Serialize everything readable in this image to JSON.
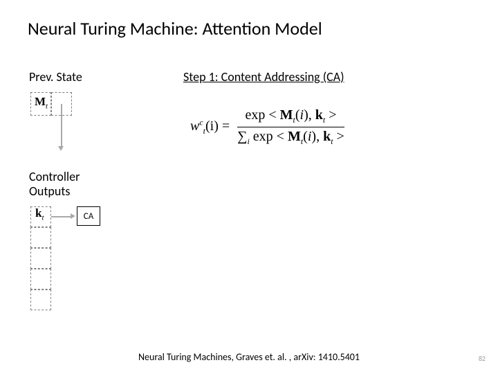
{
  "title": "Neural Turing Machine: Attention Model",
  "prev_state_label": "Prev. State",
  "controller_label_line1": "Controller",
  "controller_label_line2": "Outputs",
  "step_label": "Step 1: Content Addressing (CA)",
  "memory_symbol": "M",
  "memory_sub": "t",
  "key_symbol": "k",
  "key_sub": "t",
  "ca_box": "CA",
  "formula": {
    "lhs_w": "w",
    "lhs_sup": "c",
    "lhs_sub": "t",
    "lhs_arg": "(i) =",
    "num": "exp < M<sub>t</sub>(i), k<sub>t</sub> >",
    "den_prefix": "∑",
    "den_sub": "i",
    "den_rest": " exp < M<sub>t</sub>(i), k<sub>t</sub> >"
  },
  "citation": "Neural Turing Machines, Graves et. al. , arXiv: 1410.5401",
  "page_num": "82"
}
